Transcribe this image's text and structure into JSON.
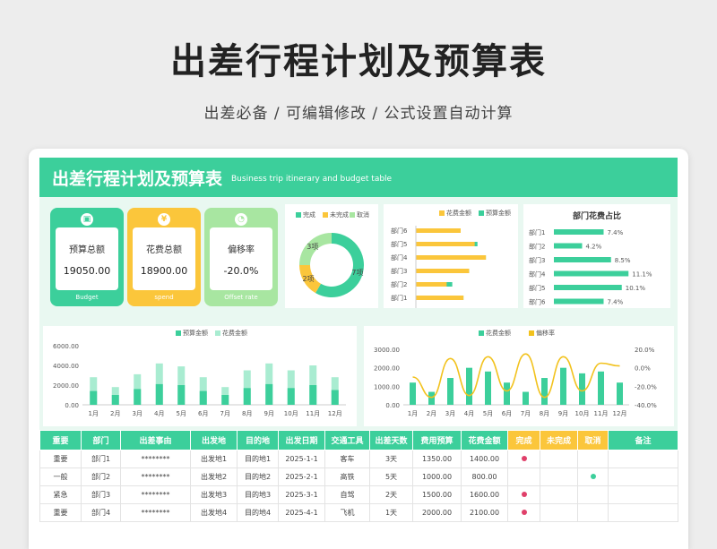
{
  "header": {
    "title": "出差行程计划及预算表",
    "subtitle": "出差必备 /  可编辑修改  /  公式设置自动计算"
  },
  "banner": {
    "title": "出差行程计划及预算表",
    "subtitle_en": "Business trip itinerary and budget table"
  },
  "colors": {
    "green": "#3ccf9b",
    "yellow": "#fbc63b",
    "light_green": "#a8e6a1",
    "pale_green": "#a9ecd1",
    "red": "#e0406a"
  },
  "kpis": [
    {
      "label": "预算总额",
      "value": "19050.00",
      "foot": "Budget",
      "icon": "wallet-icon",
      "icon_glyph": "▣",
      "color": "#3ccf9b"
    },
    {
      "label": "花费总额",
      "value": "18900.00",
      "foot": "spend",
      "icon": "coin-icon",
      "icon_glyph": "¥",
      "color": "#fbc63b"
    },
    {
      "label": "偏移率",
      "value": "-20.0%",
      "foot": "Offset rate",
      "icon": "gauge-icon",
      "icon_glyph": "◔",
      "color": "#a8e6a1"
    }
  ],
  "chart_data": [
    {
      "type": "pie",
      "variant": "donut",
      "legend": [
        "完成",
        "未完成",
        "取消"
      ],
      "labels": [
        "7项",
        "2项",
        "3项"
      ],
      "values": [
        7,
        2,
        3
      ],
      "colors": [
        "#3ccf9b",
        "#fbc63b",
        "#a8e6a1"
      ]
    },
    {
      "type": "bar",
      "orientation": "horizontal",
      "categories": [
        "部门6",
        "部门5",
        "部门4",
        "部门3",
        "部门2",
        "部门1"
      ],
      "series": [
        {
          "name": "花费金额",
          "values": [
            1600,
            2100,
            2500,
            1900,
            1100,
            1700
          ],
          "color": "#fbc63b"
        },
        {
          "name": "预算金额",
          "values": [
            1600,
            2200,
            2500,
            1900,
            1300,
            1700
          ],
          "color": "#3ccf9b"
        }
      ],
      "legend": [
        "花费金额",
        "预算金额"
      ],
      "xlim": [
        0,
        3200
      ]
    },
    {
      "type": "bar",
      "orientation": "horizontal",
      "title": "部门花费占比",
      "categories": [
        "部门1",
        "部门2",
        "部门3",
        "部门4",
        "部门5",
        "部门6"
      ],
      "values": [
        7.4,
        4.2,
        8.5,
        11.1,
        10.1,
        7.4
      ],
      "value_labels": [
        "7.4%",
        "4.2%",
        "8.5%",
        "11.1%",
        "10.1%",
        "7.4%"
      ],
      "color": "#3ccf9b",
      "xlim": [
        0,
        12
      ]
    },
    {
      "type": "bar",
      "categories": [
        "1月",
        "2月",
        "3月",
        "4月",
        "5月",
        "6月",
        "7月",
        "8月",
        "9月",
        "10月",
        "11月",
        "12月"
      ],
      "series": [
        {
          "name": "预算金额",
          "values": [
            1400,
            1000,
            1600,
            2100,
            2000,
            1400,
            1000,
            1700,
            2100,
            1700,
            2000,
            1500
          ],
          "color": "#3ccf9b"
        },
        {
          "name": "花费金额",
          "values": [
            2800,
            1800,
            3100,
            4200,
            3900,
            2800,
            1800,
            3500,
            4200,
            3500,
            4000,
            2800
          ],
          "color": "#a9ecd1"
        }
      ],
      "legend": [
        "预算金额",
        "花费金额"
      ],
      "yticks": [
        "6000.00",
        "4000.00",
        "2000.00",
        "0.00"
      ],
      "ylim": [
        0,
        6000
      ]
    },
    {
      "type": "bar+line",
      "categories": [
        "1月",
        "2月",
        "3月",
        "4月",
        "5月",
        "6月",
        "7月",
        "8月",
        "9月",
        "10月",
        "11月",
        "12月"
      ],
      "series": [
        {
          "name": "花费金额",
          "values": [
            1200,
            700,
            1450,
            2000,
            1800,
            1200,
            700,
            1450,
            2000,
            1700,
            1800,
            1200
          ],
          "color": "#3ccf9b",
          "kind": "bar"
        },
        {
          "name": "偏移率",
          "values": [
            -10,
            -32,
            10,
            -30,
            12,
            -25,
            15,
            -32,
            12,
            -25,
            5,
            2
          ],
          "color": "#f2c21d",
          "kind": "line"
        }
      ],
      "legend": [
        "花费金额",
        "偏移率"
      ],
      "yticks_left": [
        "3000.00",
        "2000.00",
        "1000.00",
        "0.00"
      ],
      "yticks_right": [
        "20.0%",
        "0.0%",
        "-20.0%",
        "-40.0%"
      ],
      "ylim_left": [
        0,
        3000
      ],
      "ylim_right": [
        -40,
        20
      ]
    }
  ],
  "table": {
    "headers": [
      "重要",
      "部门",
      "出差事由",
      "出发地",
      "目的地",
      "出发日期",
      "交通工具",
      "出差天数",
      "费用预算",
      "花费金额",
      "完成",
      "未完成",
      "取消",
      "备注"
    ],
    "rows": [
      {
        "cells": [
          "重要",
          "部门1",
          "********",
          "出发地1",
          "目的地1",
          "2025-1-1",
          "客车",
          "3天",
          "1350.00",
          "1400.00",
          "",
          "",
          "",
          ""
        ],
        "status": "完成"
      },
      {
        "cells": [
          "一般",
          "部门2",
          "********",
          "出发地2",
          "目的地2",
          "2025-2-1",
          "高铁",
          "5天",
          "1000.00",
          "800.00",
          "",
          "",
          "",
          ""
        ],
        "status": "取消"
      },
      {
        "cells": [
          "紧急",
          "部门3",
          "********",
          "出发地3",
          "目的地3",
          "2025-3-1",
          "自驾",
          "2天",
          "1500.00",
          "1600.00",
          "",
          "",
          "",
          ""
        ],
        "status": "完成"
      },
      {
        "cells": [
          "重要",
          "部门4",
          "********",
          "出发地4",
          "目的地4",
          "2025-4-1",
          "飞机",
          "1天",
          "2000.00",
          "2100.00",
          "",
          "",
          "",
          ""
        ],
        "status": "完成"
      }
    ]
  }
}
